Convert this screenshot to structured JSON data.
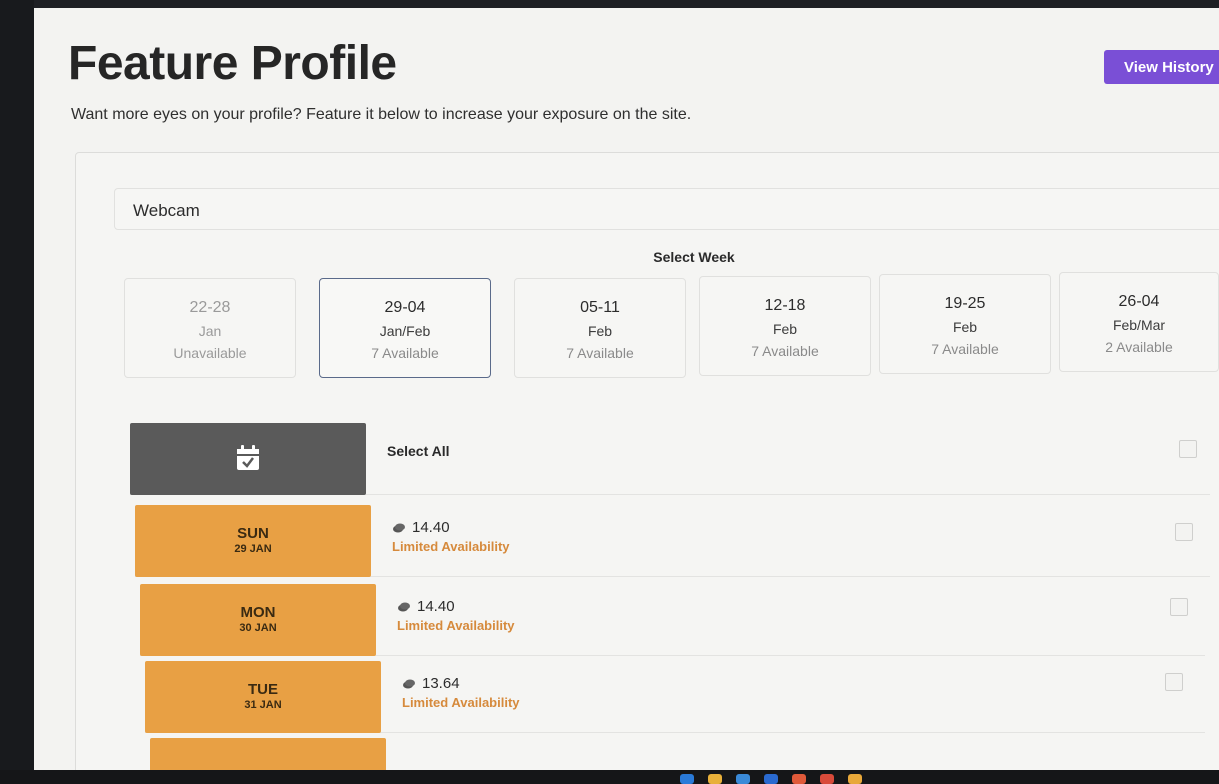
{
  "header": {
    "title": "Feature Profile",
    "view_history": "View History",
    "subtitle": "Want more eyes on your profile? Feature it below to increase your exposure on the site."
  },
  "category_select": {
    "value": "Webcam"
  },
  "weeks": {
    "label": "Select Week",
    "items": [
      {
        "range": "22-28",
        "month": "Jan",
        "availability": "Unavailable"
      },
      {
        "range": "29-04",
        "month": "Jan/Feb",
        "availability": "7 Available"
      },
      {
        "range": "05-11",
        "month": "Feb",
        "availability": "7 Available"
      },
      {
        "range": "12-18",
        "month": "Feb",
        "availability": "7 Available"
      },
      {
        "range": "19-25",
        "month": "Feb",
        "availability": "7 Available"
      },
      {
        "range": "26-04",
        "month": "Feb/Mar",
        "availability": "2 Available"
      }
    ]
  },
  "select_all": "Select All",
  "days": [
    {
      "name": "SUN",
      "date": "29 JAN",
      "price": "14.40",
      "status": "Limited Availability"
    },
    {
      "name": "MON",
      "date": "30 JAN",
      "price": "14.40",
      "status": "Limited Availability"
    },
    {
      "name": "TUE",
      "date": "31 JAN",
      "price": "13.64",
      "status": "Limited Availability"
    }
  ],
  "colors": {
    "accent_button": "#7a4fd6",
    "day_block": "#e8a044",
    "calendar_block": "#5a5a5a",
    "limited_text": "#d68a3c"
  },
  "icons": {
    "calendar": "calendar-check-icon",
    "credit": "coin-icon"
  }
}
